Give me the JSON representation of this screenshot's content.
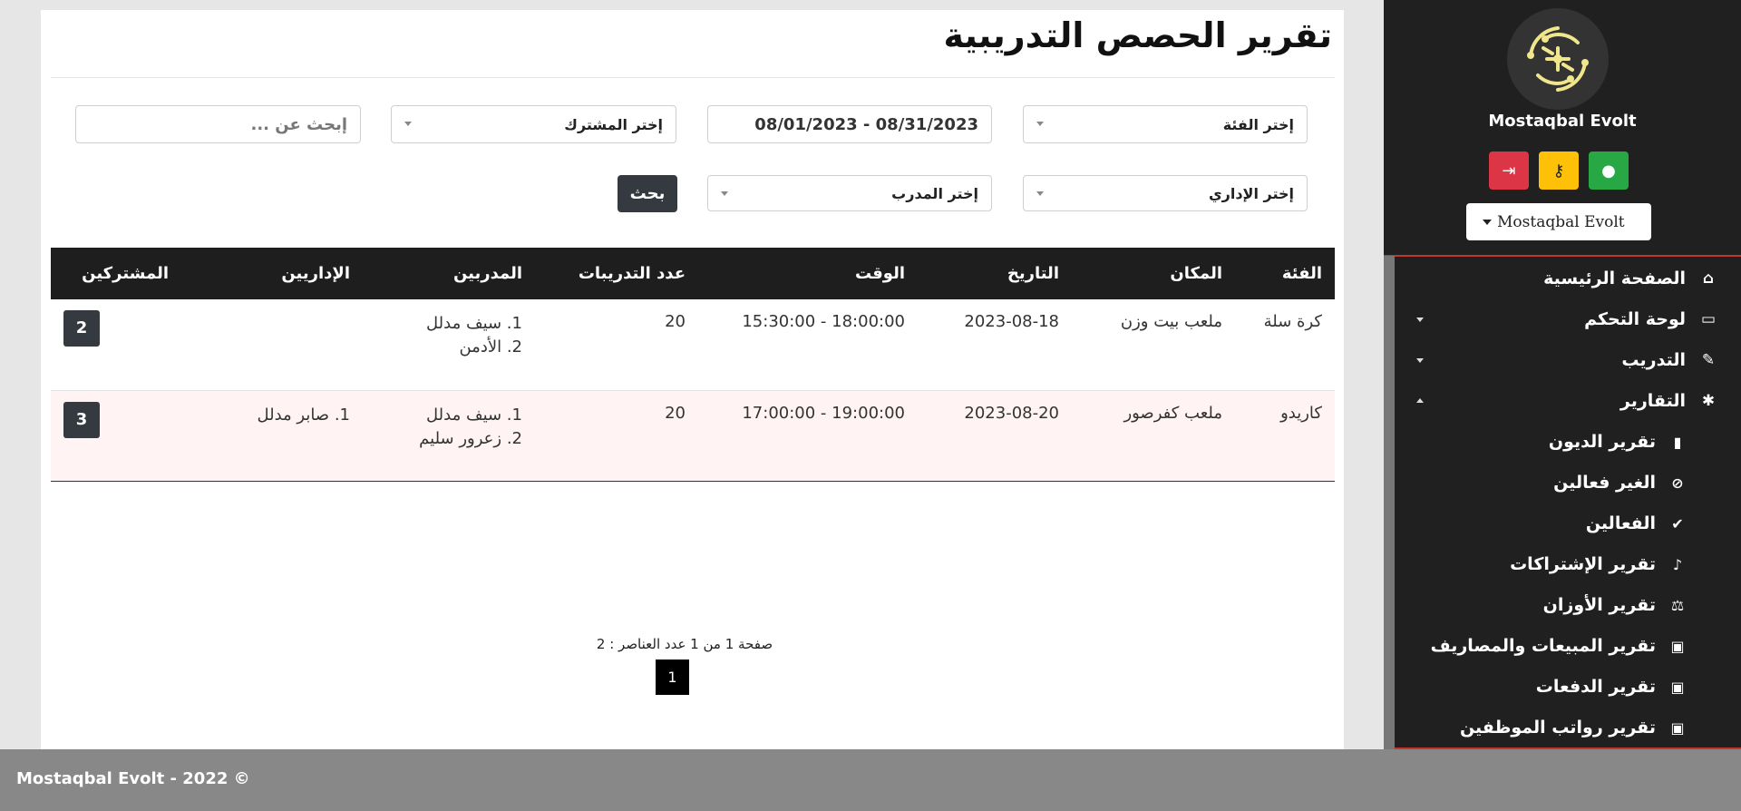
{
  "page": {
    "title": "تقرير الحصص التدريبية"
  },
  "filters": {
    "category_select": "إختر الفئة",
    "date_range": "08/31/2023 - 08/01/2023",
    "subscriber_select": "إختر المشترك",
    "search_placeholder": "إبحث عن ...",
    "admin_select": "إختر الإداري",
    "trainer_select": "إختر المدرب",
    "search_button": "بحث"
  },
  "table": {
    "headers": [
      "الفئة",
      "المكان",
      "التاريخ",
      "الوقت",
      "عدد التدريبات",
      "المدربين",
      "الإداريين",
      "المشتركين"
    ],
    "rows": [
      {
        "category": "كرة سلة",
        "place": "ملعب بيت وزن",
        "date": "2023-08-18",
        "time": "18:00:00 - 15:30:00",
        "count": "20",
        "trainer1": "1. سيف مدلل",
        "trainer2": "2. الأدمن",
        "admin1": "",
        "subscribers": "2"
      },
      {
        "category": "كاريدو",
        "place": "ملعب كفرصور",
        "date": "2023-08-20",
        "time": "19:00:00 - 17:00:00",
        "count": "20",
        "trainer1": "1. سيف مدلل",
        "trainer2": "2. زعرور سليم",
        "admin1": "1. صابر مدلل",
        "subscribers": "3"
      }
    ]
  },
  "pagination": {
    "info": "صفحة 1 من 1 عدد العناصر : 2",
    "current_page": "1"
  },
  "sidebar": {
    "brand": "Mostaqbal Evolt",
    "dropdown": "Mostaqbal Evolt",
    "buttons": {
      "logout_color": "#dc3545",
      "key_color": "#ffc107",
      "user_color": "#28a745"
    },
    "nav": {
      "home": "الصفحة الرئيسية",
      "dashboard": "لوحة التحكم",
      "training": "التدريب",
      "reports": "التقارير"
    },
    "reports": {
      "debts": "تقرير الديون",
      "inactive": "الغير فعالين",
      "active": "الفعالين",
      "subscriptions": "تقرير الإشتراكات",
      "weights": "تقرير الأوزان",
      "sales": "تقرير المبيعات والمصاريف",
      "payments": "تقرير الدفعات",
      "salaries": "تقرير رواتب الموظفين"
    }
  },
  "footer": {
    "copyright": "Mostaqbal Evolt - 2022 ©"
  }
}
